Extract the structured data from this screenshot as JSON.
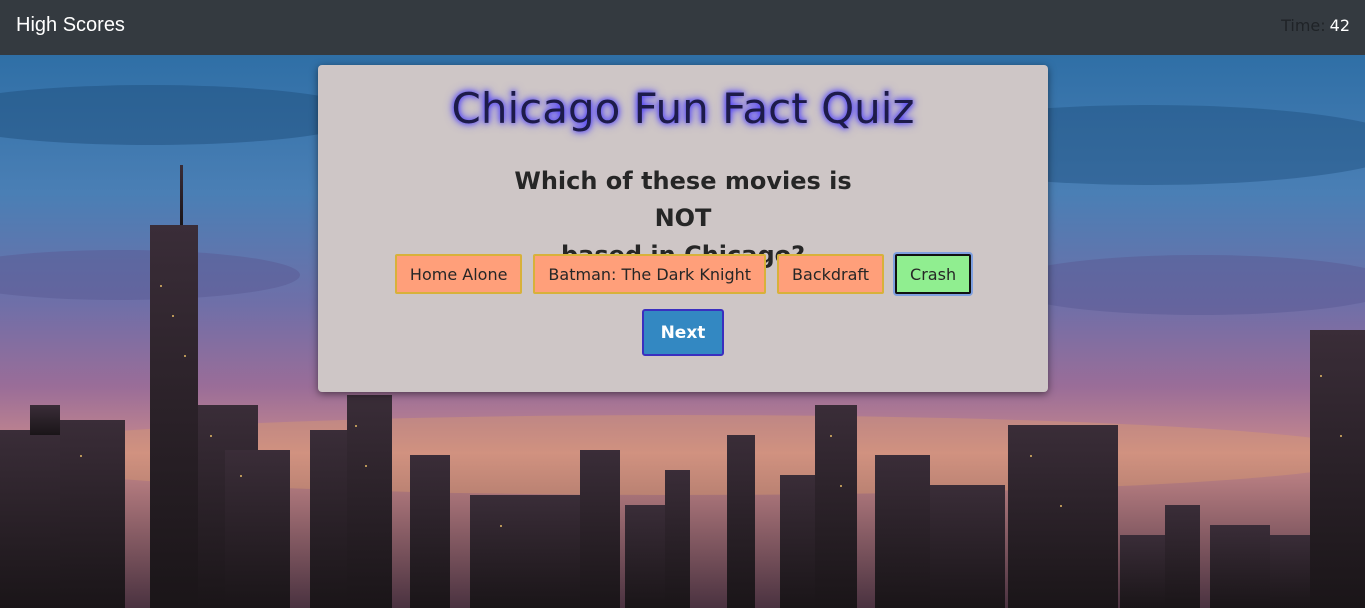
{
  "navbar": {
    "high_scores_label": "High Scores",
    "timer_label": "Time:",
    "timer_value": "42"
  },
  "quiz": {
    "title": "Chicago Fun Fact Quiz",
    "question_line1": "Which of these movies is NOT",
    "question_line2": "based in Chicago?",
    "answers": [
      {
        "label": "Home Alone",
        "state": "default"
      },
      {
        "label": "Batman: The Dark Knight",
        "state": "default"
      },
      {
        "label": "Backdraft",
        "state": "default"
      },
      {
        "label": "Crash",
        "state": "correct"
      }
    ],
    "next_label": "Next"
  },
  "colors": {
    "navbar_bg": "#343a40",
    "card_bg": "#cec6c6",
    "answer_bg": "#ff9f7a",
    "correct_bg": "#90ee90",
    "next_bg": "#3388c2"
  }
}
